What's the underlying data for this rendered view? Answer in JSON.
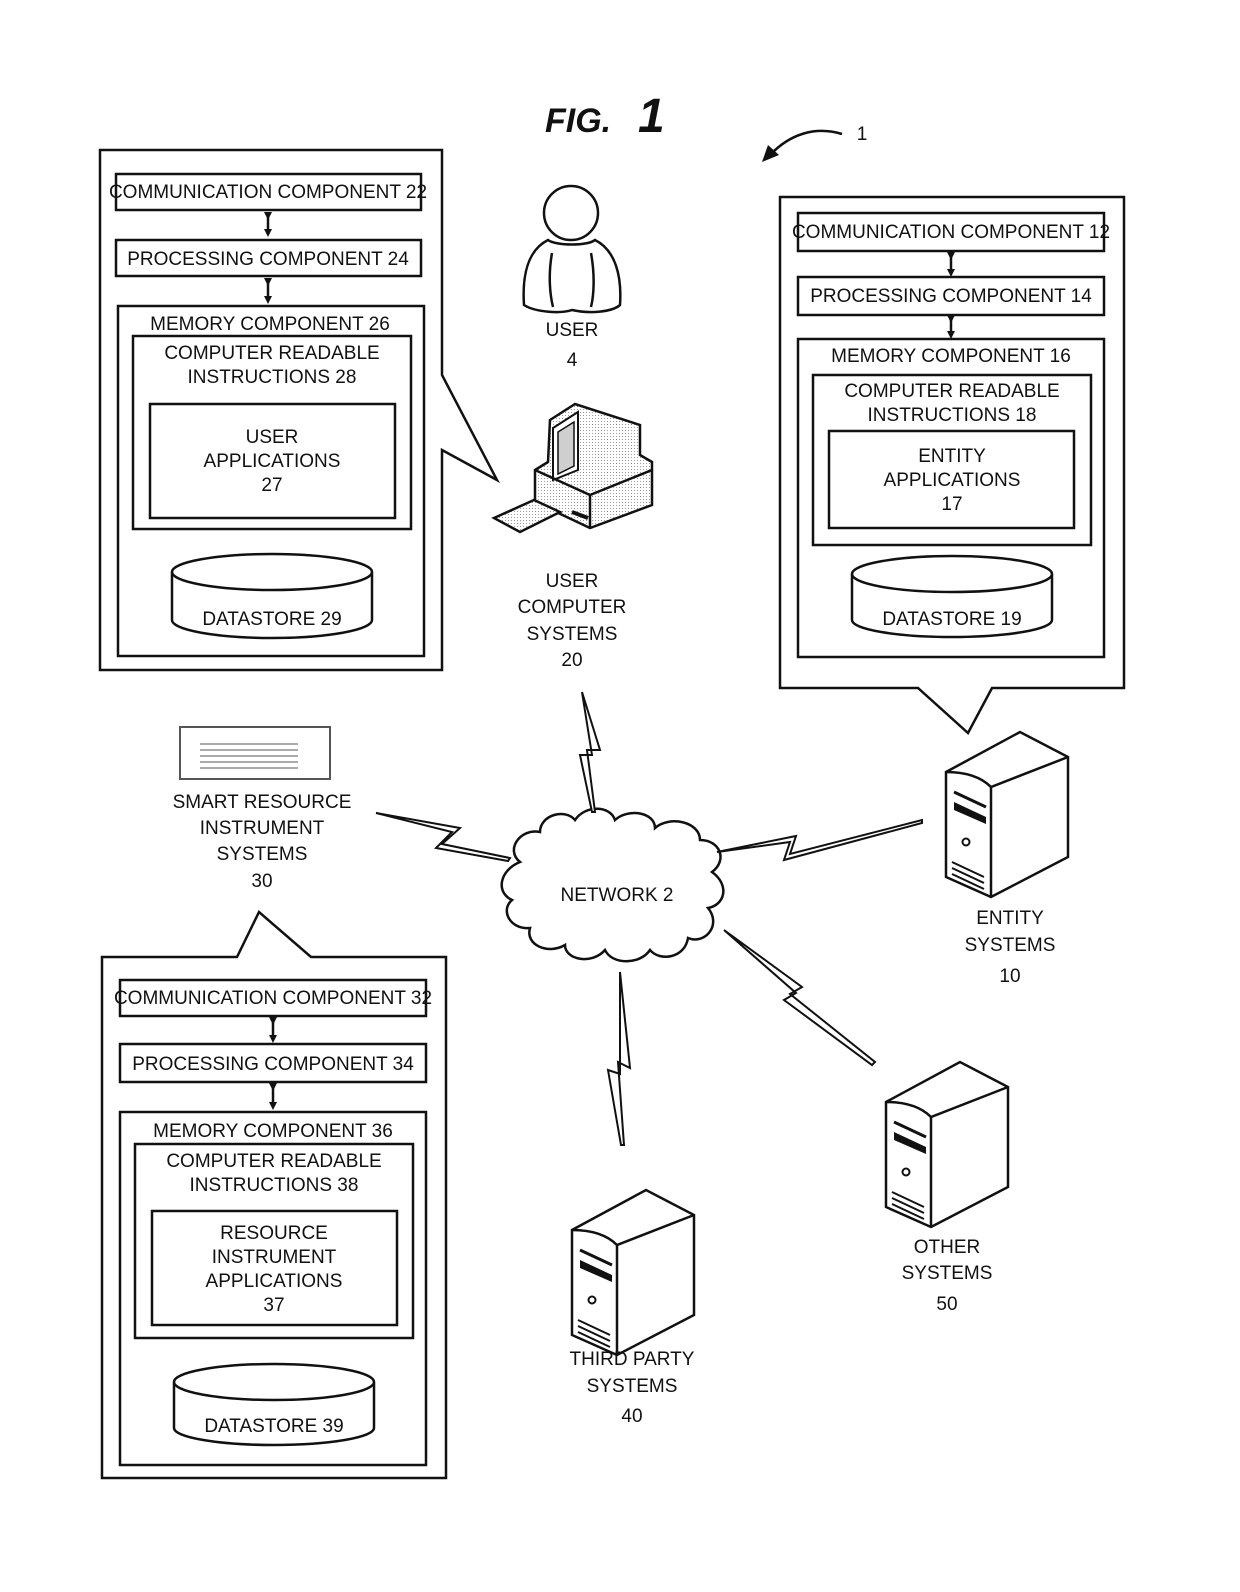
{
  "figure": {
    "title_fig": "FIG.",
    "title_num": "1",
    "ref_number": "1"
  },
  "user": {
    "label": "USER",
    "number": "4"
  },
  "user_computer": {
    "lines": [
      "USER",
      "COMPUTER",
      "SYSTEMS"
    ],
    "number": "20"
  },
  "user_panel": {
    "communication": "COMMUNICATION COMPONENT 22",
    "processing": "PROCESSING COMPONENT 24",
    "memory": "MEMORY COMPONENT 26",
    "instructions": [
      "COMPUTER READABLE",
      "INSTRUCTIONS 28"
    ],
    "applications": [
      "USER",
      "APPLICATIONS",
      "27"
    ],
    "datastore": "DATASTORE 29"
  },
  "entity_panel": {
    "communication": "COMMUNICATION COMPONENT 12",
    "processing": "PROCESSING COMPONENT  14",
    "memory": "MEMORY COMPONENT  16",
    "instructions": [
      "COMPUTER READABLE",
      "INSTRUCTIONS 18"
    ],
    "applications": [
      "ENTITY",
      "APPLICATIONS",
      "17"
    ],
    "datastore": "DATASTORE 19"
  },
  "resource_panel": {
    "communication": "COMMUNICATION COMPONENT 32",
    "processing": "PROCESSING COMPONENT 34",
    "memory": "MEMORY COMPONENT 36",
    "instructions": [
      "COMPUTER READABLE",
      "INSTRUCTIONS 38"
    ],
    "applications": [
      "RESOURCE",
      "INSTRUMENT",
      "APPLICATIONS",
      "37"
    ],
    "datastore": "DATASTORE 39"
  },
  "smart_resource": {
    "lines": [
      "SMART RESOURCE",
      "INSTRUMENT",
      "SYSTEMS"
    ],
    "number": "30"
  },
  "network": {
    "label": "NETWORK 2"
  },
  "entity_systems": {
    "lines": [
      "ENTITY",
      "SYSTEMS"
    ],
    "number": "10"
  },
  "third_party": {
    "lines": [
      "THIRD PARTY",
      "SYSTEMS"
    ],
    "number": "40"
  },
  "other_systems": {
    "lines": [
      "OTHER",
      "SYSTEMS"
    ],
    "number": "50"
  }
}
